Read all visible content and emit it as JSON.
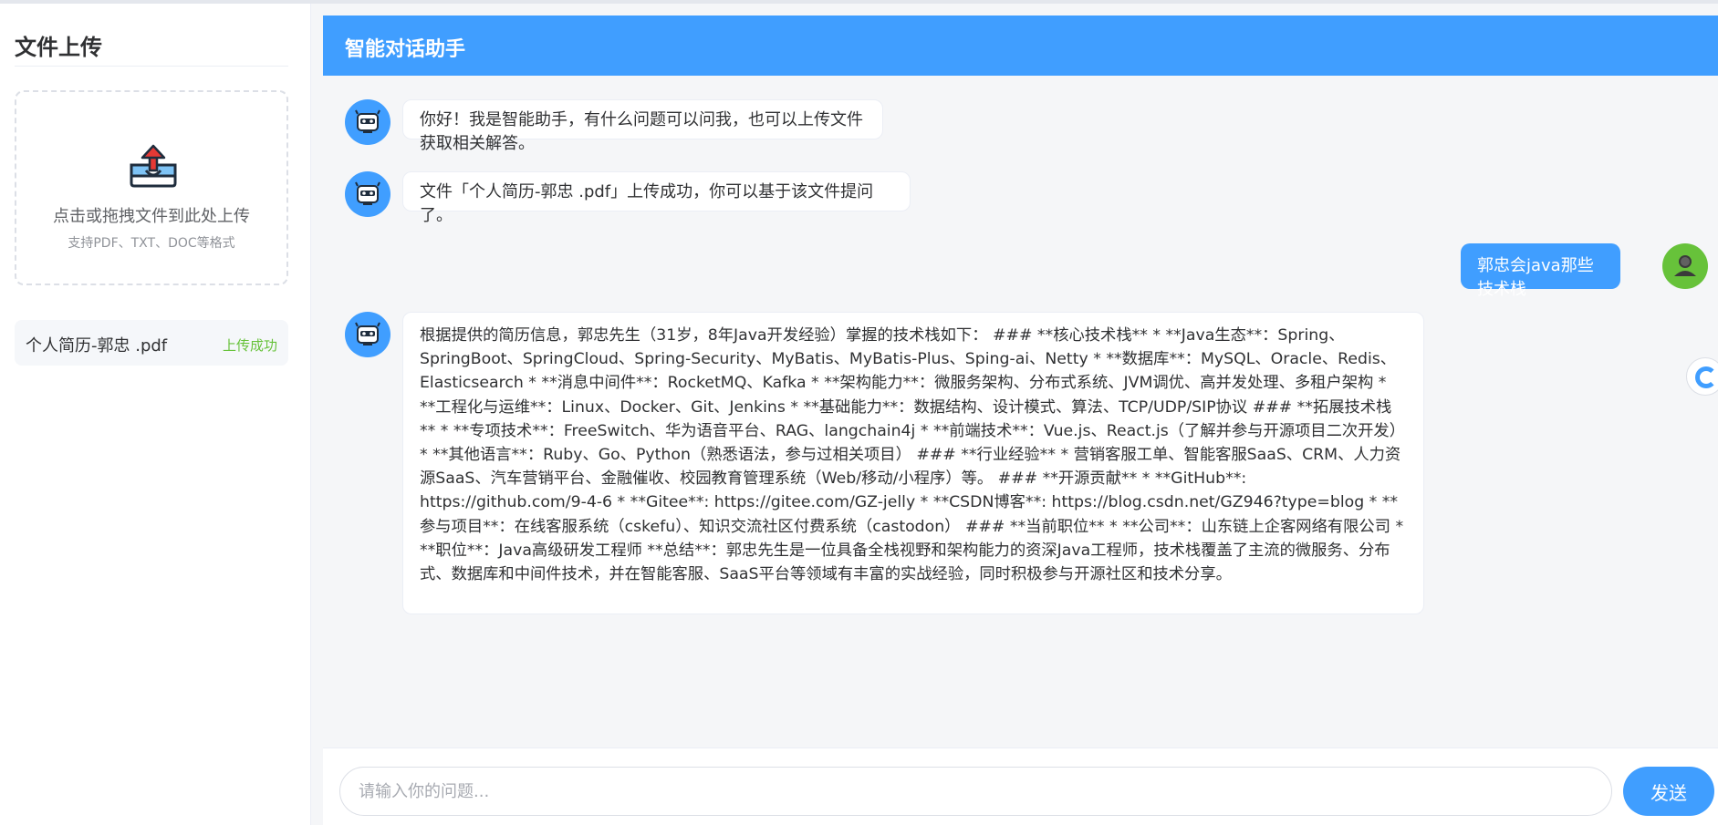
{
  "sidebar": {
    "title": "文件上传",
    "upload": {
      "hint": "点击或拖拽文件到此处上传",
      "sub": "支持PDF、TXT、DOC等格式",
      "icon": "upload-tray-icon"
    },
    "files": [
      {
        "name": "个人简历-郭忠 .pdf",
        "status": "上传成功"
      }
    ]
  },
  "chat": {
    "title": "智能对话助手",
    "messages": [
      {
        "role": "assistant",
        "text": "你好！我是智能助手，有什么问题可以问我，也可以上传文件获取相关解答。"
      },
      {
        "role": "assistant",
        "text": "文件「个人简历-郭忠 .pdf」上传成功，你可以基于该文件提问了。"
      },
      {
        "role": "user",
        "text": "郭忠会java那些技术栈"
      },
      {
        "role": "assistant",
        "text": "根据提供的简历信息，郭忠先生（31岁，8年Java开发经验）掌握的技术栈如下： ### **核心技术栈** * **Java生态**：Spring、SpringBoot、SpringCloud、Spring-Security、MyBatis、MyBatis-Plus、Sping-ai、Netty * **数据库**：MySQL、Oracle、Redis、Elasticsearch * **消息中间件**：RocketMQ、Kafka * **架构能力**：微服务架构、分布式系统、JVM调优、高并发处理、多租户架构 * **工程化与运维**：Linux、Docker、Git、Jenkins * **基础能力**：数据结构、设计模式、算法、TCP/UDP/SIP协议 ### **拓展技术栈** * **专项技术**：FreeSwitch、华为语音平台、RAG、langchain4j * **前端技术**：Vue.js、React.js（了解并参与开源项目二次开发） * **其他语言**：Ruby、Go、Python（熟悉语法，参与过相关项目） ### **行业经验** * 营销客服工单、智能客服SaaS、CRM、人力资源SaaS、汽车营销平台、金融催收、校园教育管理系统（Web/移动/小程序）等。 ### **开源贡献** * **GitHub**: https://github.com/9-4-6 * **Gitee**: https://gitee.com/GZ-jelly * **CSDN博客**: https://blog.csdn.net/GZ946?type=blog * **参与项目**：在线客服系统（cskefu）、知识交流社区付费系统（castodon） ### **当前职位** * **公司**：山东链上企客网络有限公司 * **职位**：Java高级研发工程师 **总结**：郭忠先生是一位具备全栈视野和架构能力的资深Java工程师，技术栈覆盖了主流的微服务、分布式、数据库和中间件技术，并在智能客服、SaaS平台等领域有丰富的实战经验，同时积极参与开源社区和技术分享。"
      }
    ]
  },
  "input": {
    "placeholder": "请输入你的问题...",
    "value": "",
    "send_label": "发送"
  },
  "colors": {
    "accent": "#409eff",
    "success": "#67c23a"
  }
}
